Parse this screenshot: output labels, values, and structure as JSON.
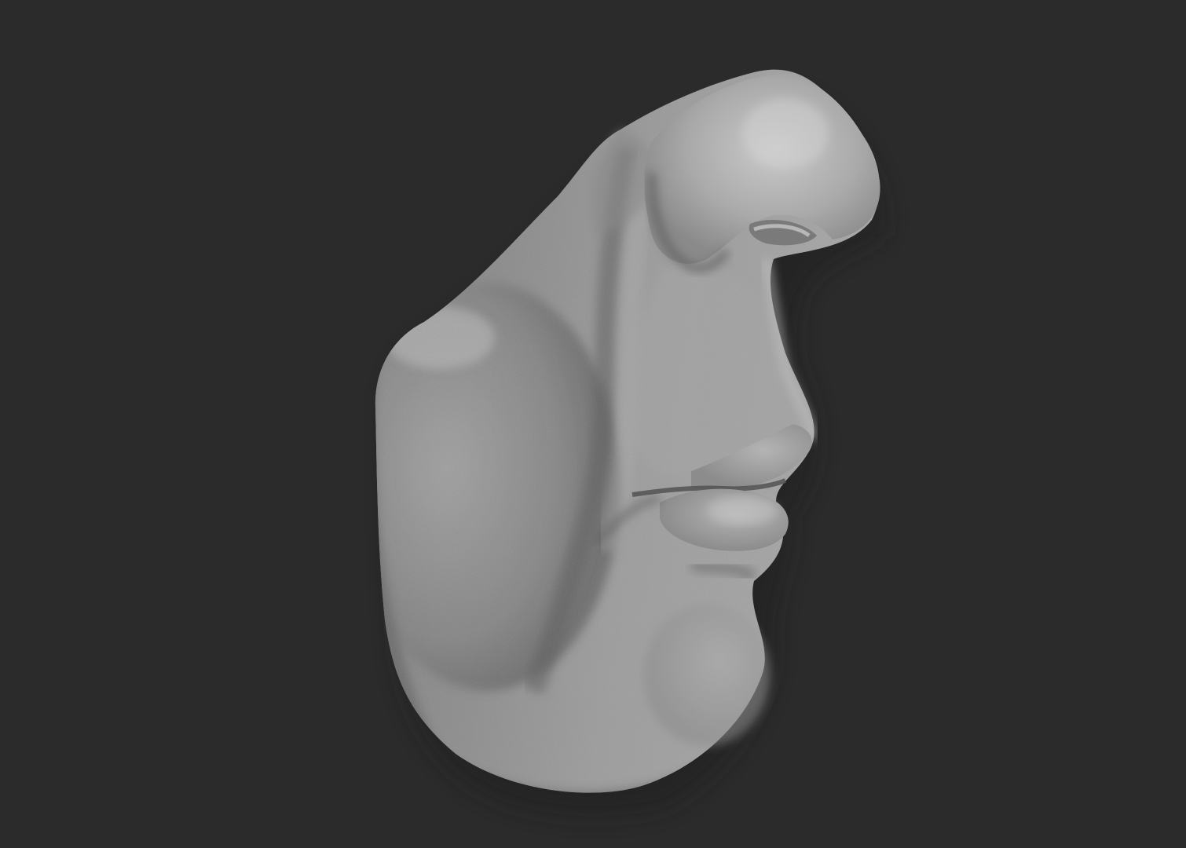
{
  "scene": {
    "background_color": "#2b2b2b",
    "subject": "sculpt-nose-mouth",
    "material_color": "#9a9a9a"
  }
}
